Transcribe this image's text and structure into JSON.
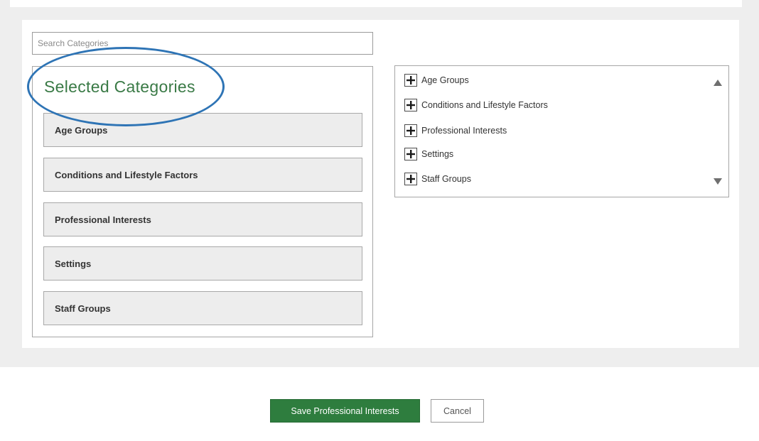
{
  "search": {
    "placeholder": "Search Categories"
  },
  "selected": {
    "title": "Selected Categories",
    "items": [
      {
        "label": "Age Groups"
      },
      {
        "label": "Conditions and Lifestyle Factors"
      },
      {
        "label": "Professional Interests"
      },
      {
        "label": "Settings"
      },
      {
        "label": "Staff Groups"
      }
    ]
  },
  "tree": {
    "items": [
      {
        "label": "Age Groups",
        "icon": "plus-icon"
      },
      {
        "label": "Conditions and Lifestyle Factors",
        "icon": "plus-icon"
      },
      {
        "label": "Professional Interests",
        "icon": "plus-icon"
      },
      {
        "label": "Settings",
        "icon": "plus-icon"
      },
      {
        "label": "Staff Groups",
        "icon": "plus-icon"
      }
    ]
  },
  "actions": {
    "save_label": "Save Professional Interests",
    "cancel_label": "Cancel"
  },
  "colors": {
    "accent_green": "#2e7d3e",
    "title_green": "#3a7a46",
    "annotation_blue": "#2e74b5",
    "panel_grey": "#eeeeee"
  }
}
